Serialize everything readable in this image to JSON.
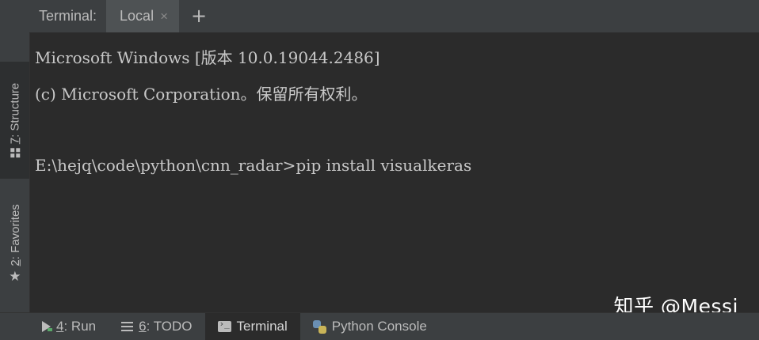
{
  "tool_window": {
    "title": "Terminal:",
    "tabs": [
      {
        "label": "Local",
        "close": "×"
      }
    ],
    "add_tab": "+"
  },
  "left_strip": {
    "structure": {
      "prefix": "7",
      "label": ": Structure"
    },
    "favorites": {
      "prefix": "2",
      "label": ": Favorites"
    }
  },
  "terminal": {
    "lines": [
      "Microsoft Windows [版本 10.0.19044.2486]",
      "(c) Microsoft Corporation。保留所有权利。",
      "",
      "E:\\hejq\\code\\python\\cnn_radar>pip install visualkeras"
    ]
  },
  "watermark": "知乎 @Messi",
  "bottom_bar": {
    "items": [
      {
        "prefix": "4",
        "label": ": Run",
        "icon": "run-icon"
      },
      {
        "prefix": "6",
        "label": ": TODO",
        "icon": "todo-icon"
      },
      {
        "prefix": "",
        "label": "Terminal",
        "icon": "terminal-icon",
        "active": true
      },
      {
        "prefix": "",
        "label": "Python Console",
        "icon": "python-icon"
      }
    ]
  },
  "colors": {
    "background": "#2b2b2b",
    "panel": "#3c3f41",
    "text": "#bbbbbb",
    "terminal_text": "#c8c8c8"
  }
}
